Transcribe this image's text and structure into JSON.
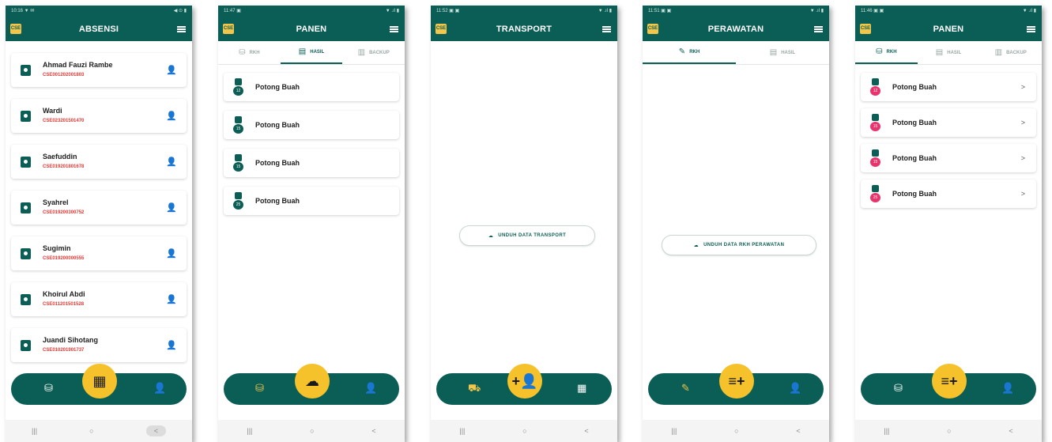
{
  "colors": {
    "primary": "#0b5e55",
    "accent": "#f6c22b",
    "id_red": "#e53935",
    "pink": "#e8336d"
  },
  "screens": [
    {
      "status_time": "10:16 ▼ ✉",
      "status_right": "◀ ⊙ ▮",
      "title": "ABSENSI",
      "employees": [
        {
          "name": "Ahmad Fauzi Rambe",
          "id": "CSE001202001803"
        },
        {
          "name": "Wardi",
          "id": "CSE023201501470"
        },
        {
          "name": "Saefuddin",
          "id": "CSE019201801678"
        },
        {
          "name": "Syahrel",
          "id": "CSE019200300752"
        },
        {
          "name": "Sugimin",
          "id": "CSE019200000555"
        },
        {
          "name": "Khoirul Abdi",
          "id": "CSE011201501528"
        },
        {
          "name": "Juandi Sihotang",
          "id": "CSE010201901737"
        }
      ],
      "nav_left_icon": "basket-icon",
      "fab_icon": "qr-scan-icon",
      "nav_right_icon": "person-clock-icon"
    },
    {
      "status_time": "11:47 ▣",
      "status_right": "▼ .ıl ▮",
      "title": "PANEN",
      "tabs": [
        {
          "label": "RKH"
        },
        {
          "label": "HASIL"
        },
        {
          "label": "BACKUP"
        }
      ],
      "active_tab": 1,
      "items": [
        {
          "label": "Potong Buah",
          "badge": "12"
        },
        {
          "label": "Potong Buah",
          "badge": "15"
        },
        {
          "label": "Potong Buah",
          "badge": "15"
        },
        {
          "label": "Potong Buah",
          "badge": "25"
        }
      ],
      "nav_left_icon": "basket-icon",
      "fab_icon": "cloud-upload-icon",
      "nav_right_icon": "person-clock-icon"
    },
    {
      "status_time": "11:52 ▣ ▣",
      "status_right": "▼ .ıl ▮",
      "title": "TRANSPORT",
      "download_label": "UNDUH DATA TRANSPORT",
      "nav_left_icon": "truck-icon",
      "fab_icon": "add-person-icon",
      "nav_right_icon": "calendar-icon"
    },
    {
      "status_time": "11:51 ▣ ▣",
      "status_right": "▼ .ıl ▮",
      "title": "PERAWATAN",
      "tabs": [
        {
          "label": "RKH"
        },
        {
          "label": "HASIL"
        }
      ],
      "active_tab": 0,
      "download_label": "UNDUH DATA RKH PERAWATAN",
      "nav_left_icon": "sprayer-icon",
      "fab_icon": "playlist-add-icon",
      "nav_right_icon": "person-clock-icon"
    },
    {
      "status_time": "11:46 ▣ ▣",
      "status_right": "▼ .ıl ▮",
      "title": "PANEN",
      "tabs": [
        {
          "label": "RKH"
        },
        {
          "label": "HASIL"
        },
        {
          "label": "BACKUP"
        }
      ],
      "active_tab": 0,
      "items": [
        {
          "label": "Potong Buah",
          "badge": "12"
        },
        {
          "label": "Potong Buah",
          "badge": "15"
        },
        {
          "label": "Potong Buah",
          "badge": "15"
        },
        {
          "label": "Potong Buah",
          "badge": "25"
        }
      ],
      "chevron": ">",
      "nav_left_icon": "basket-icon",
      "fab_icon": "playlist-add-icon",
      "nav_right_icon": "person-clock-icon"
    }
  ],
  "logo_text": "CSE",
  "system_nav": {
    "recent": "|||",
    "home": "○",
    "back": "<"
  }
}
